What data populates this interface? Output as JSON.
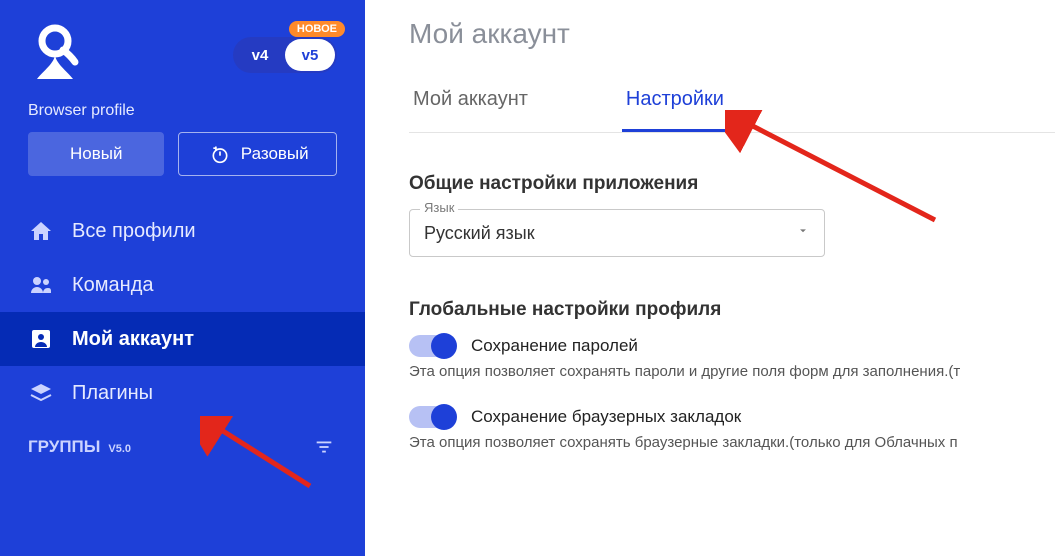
{
  "sidebar": {
    "version_switch": {
      "v4": "v4",
      "v5": "v5",
      "new_badge": "НОВОЕ"
    },
    "section_label": "Browser profile",
    "new_button": "Новый",
    "onetime_button": "Разовый",
    "nav": {
      "all_profiles": "Все профили",
      "team": "Команда",
      "my_account": "Мой аккаунт",
      "plugins": "Плагины"
    },
    "groups_label": "ГРУППЫ",
    "groups_version": "V5.0"
  },
  "main": {
    "page_title": "Мой аккаунт",
    "tabs": {
      "account": "Мой аккаунт",
      "settings": "Настройки"
    },
    "app_settings": {
      "title": "Общие настройки приложения",
      "language_label": "Язык",
      "language_value": "Русский язык"
    },
    "profile_settings": {
      "title": "Глобальные настройки профиля",
      "save_passwords_label": "Сохранение паролей",
      "save_passwords_desc": "Эта опция позволяет сохранять пароли и другие поля форм для заполнения.(т",
      "save_bookmarks_label": "Сохранение браузерных закладок",
      "save_bookmarks_desc": "Эта опция позволяет сохранять браузерные закладки.(только для Облачных п"
    }
  }
}
